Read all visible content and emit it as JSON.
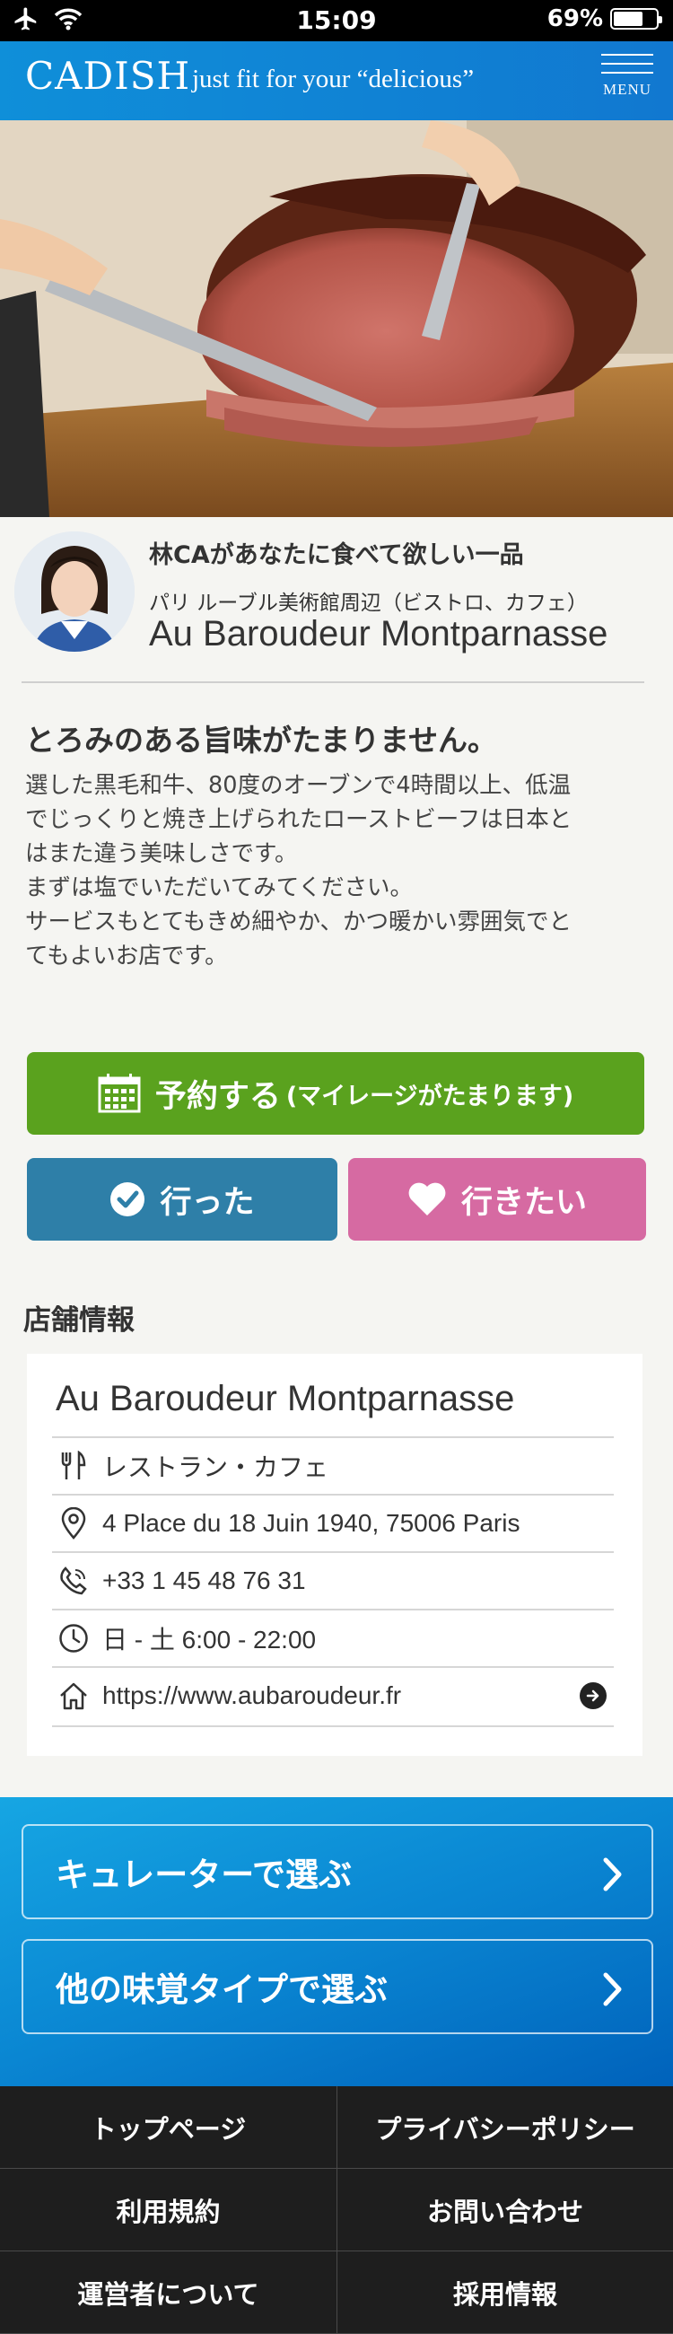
{
  "status_bar": {
    "time": "15:09",
    "battery": "69%",
    "battery_level": 0.69
  },
  "header": {
    "logo": "CADISH",
    "tagline": "just fit for your “delicious”",
    "menu_label": "MENU"
  },
  "curator": {
    "heading": "林CAがあなたに食べて欲しい一品",
    "area": "パリ ルーブル美術館周辺（ビストロ、カフェ）",
    "restaurant": "Au Baroudeur Montparnasse"
  },
  "review": {
    "headline": "とろみのある旨味がたまりません。",
    "lines": [
      "選した黒毛和牛、80度のオーブンで4時間以上、低温",
      "でじっくりと焼き上げられたローストビーフは日本と",
      "はまた違う美味しさです。",
      "まずは塩でいただいてみてください。",
      "サービスもとてもきめ細やか、かつ暖かい雰囲気でと",
      "てもよいお店です。"
    ]
  },
  "actions": {
    "reserve_label": "予約する",
    "reserve_note": "(マイレージがたまります)",
    "went_label": "行った",
    "want_label": "行きたい"
  },
  "store_info": {
    "section_title": "店舗情報",
    "name": "Au Baroudeur Montparnasse",
    "category": "レストラン・カフェ",
    "address": "4 Place du 18 Juin 1940, 75006 Paris",
    "phone": "+33 1 45 48 76 31",
    "hours": "日 - 土 6:00 - 22:00",
    "website": "https://www.aubaroudeur.fr"
  },
  "nav_links": {
    "by_curator": "キュレーターで選ぶ",
    "by_taste": "他の味覚タイプで選ぶ"
  },
  "footer": {
    "top": "トップページ",
    "privacy": "プライバシーポリシー",
    "terms": "利用規約",
    "contact": "お問い合わせ",
    "about": "運営者について",
    "careers": "採用情報"
  },
  "colors": {
    "brand_blue": "#0f8fd9",
    "reserve_green": "#5aa21e",
    "went_blue": "#2e7fa8",
    "want_pink": "#d66aa2",
    "footer_dark": "#1e1e1e"
  }
}
